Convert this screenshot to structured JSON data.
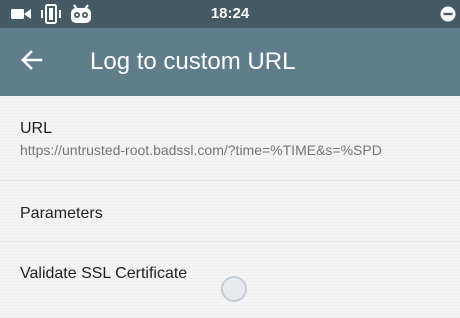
{
  "status_bar": {
    "time": "18:24",
    "left_icons": [
      "video-camera-icon",
      "vibrate-icon",
      "app-face-icon"
    ],
    "right_icons": [
      "do-not-disturb-icon"
    ]
  },
  "toolbar": {
    "title": "Log to custom URL",
    "back_icon": "arrow-back-icon",
    "color": "#607d8b",
    "status_color": "#455a64"
  },
  "preferences": {
    "url": {
      "title": "URL",
      "summary": "https://untrusted-root.badssl.com/?time=%TIME&s=%SPD"
    },
    "parameters": {
      "title": "Parameters"
    },
    "validate_ssl": {
      "title": "Validate SSL Certificate"
    }
  }
}
